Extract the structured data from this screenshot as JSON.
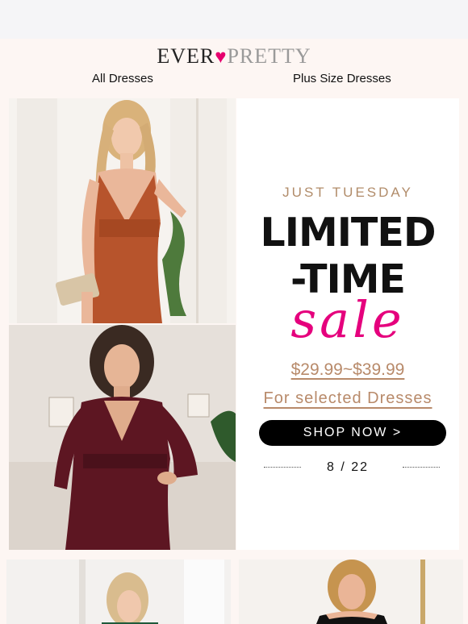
{
  "brand": {
    "part1": "EVER",
    "heart": "♥",
    "part2": "PRETTY"
  },
  "nav": {
    "all_dresses": "All Dresses",
    "plus_size": "Plus Size Dresses"
  },
  "promo": {
    "subhead": "JUST TUESDAY",
    "line1": "LIMITED",
    "line2": "-TIME",
    "script": "sale",
    "price": "$29.99~$39.99",
    "selected": "For selected Dresses",
    "cta": "SHOP NOW >",
    "date": "8 / 22"
  },
  "colors": {
    "accent_pink": "#e5007d",
    "tan": "#b88a6a",
    "button_bg": "#000000"
  },
  "icons": {
    "heart": "heart-icon"
  }
}
